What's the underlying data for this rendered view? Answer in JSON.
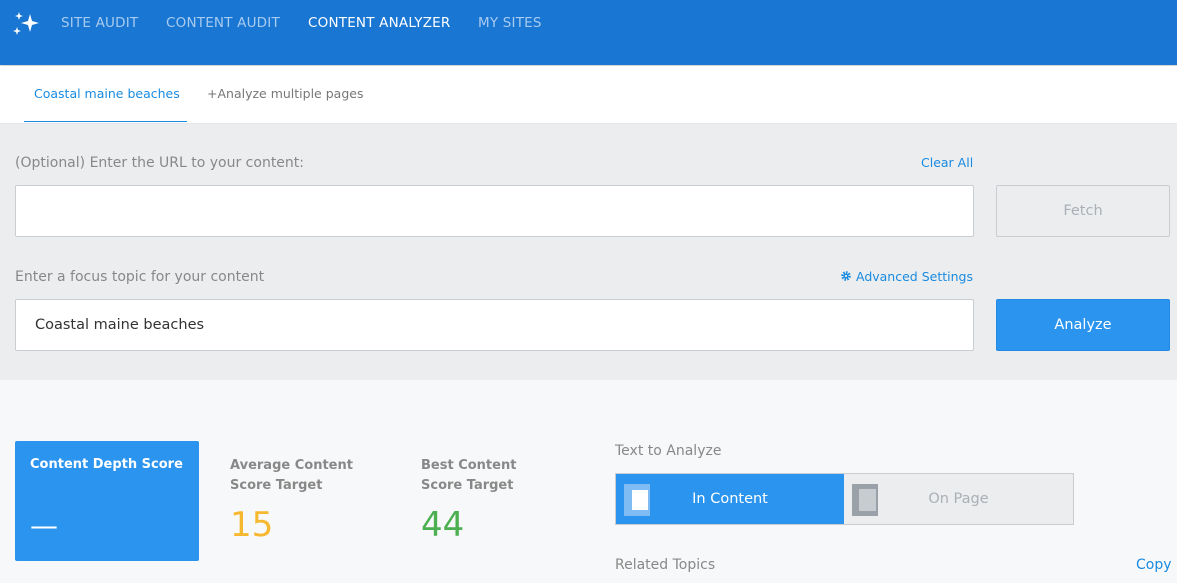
{
  "nav": {
    "items": [
      {
        "label": "SITE AUDIT"
      },
      {
        "label": "CONTENT AUDIT"
      },
      {
        "label": "CONTENT ANALYZER"
      },
      {
        "label": "MY SITES"
      }
    ],
    "active_index": 2
  },
  "tabs": [
    {
      "label": "Coastal maine beaches"
    },
    {
      "label": "+Analyze multiple pages"
    }
  ],
  "form": {
    "url_label": "(Optional) Enter the URL to your content:",
    "clear_all": "Clear All",
    "url_value": "",
    "fetch_label": "Fetch",
    "topic_label": "Enter a focus topic for your content",
    "advanced_settings": "Advanced Settings",
    "topic_value": "Coastal maine beaches",
    "analyze_label": "Analyze"
  },
  "scores": {
    "depth_title": "Content Depth Score",
    "depth_value": "—",
    "avg_title": "Average Content Score Target",
    "avg_value": "15",
    "best_title": "Best Content Score Target",
    "best_value": "44"
  },
  "analyze_text": {
    "label": "Text to Analyze",
    "options": [
      {
        "label": "In Content"
      },
      {
        "label": "On Page"
      }
    ],
    "selected_index": 0
  },
  "related": {
    "label": "Related Topics",
    "copy": "Copy"
  },
  "colors": {
    "header_bg": "#1976d2",
    "accent": "#2b94ee",
    "link": "#1a8be0",
    "avg_score": "#f5b82e",
    "best_score": "#4caf50"
  },
  "icons": {
    "logo": "sparkle-icon",
    "settings": "gear-icon",
    "in_content": "page-inset-icon",
    "on_page": "page-layout-icon"
  }
}
